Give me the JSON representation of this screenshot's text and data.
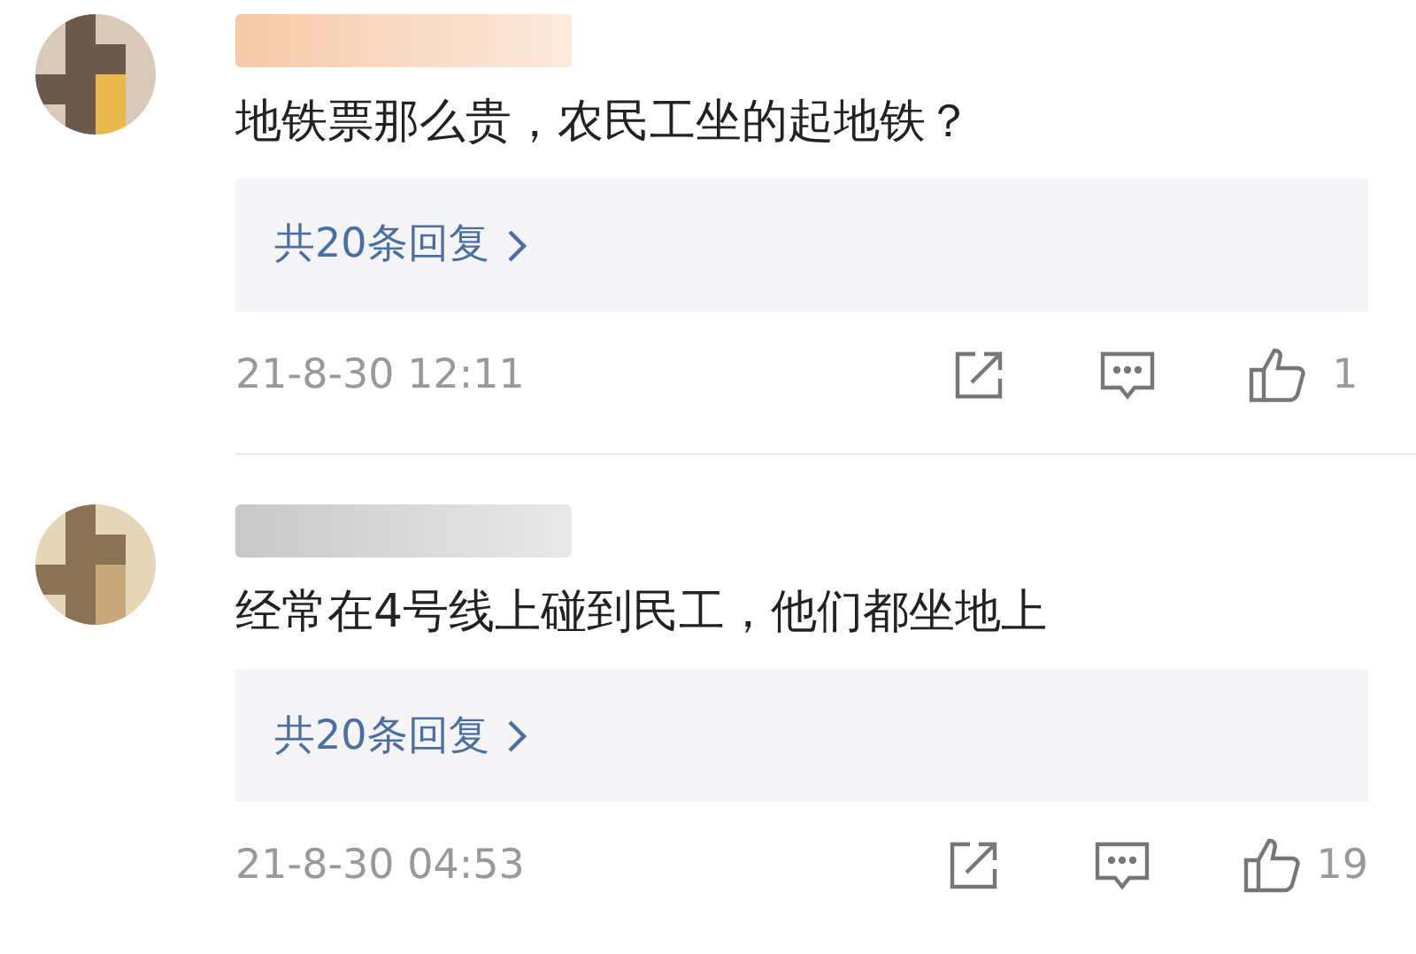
{
  "comments": [
    {
      "text": "地铁票那么贵，农民工坐的起地铁？",
      "replies_link": "共20条回复",
      "date": "21-8-30 12:11",
      "likes": "1"
    },
    {
      "text": "经常在4号线上碰到民工，他们都坐地上",
      "replies_link": "共20条回复",
      "date": "21-8-30 04:53",
      "likes": "19"
    }
  ]
}
